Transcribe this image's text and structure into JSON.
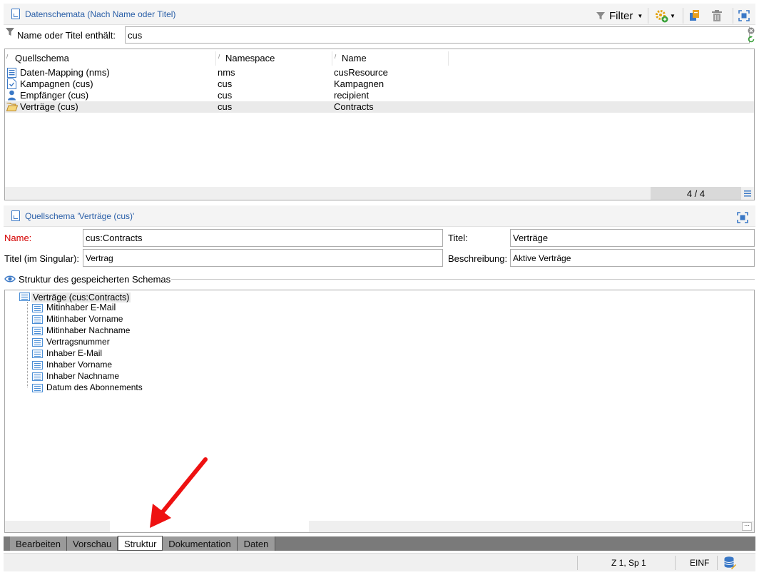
{
  "top_panel": {
    "title": "Datenschemata (Nach Name oder Titel)",
    "filter_label": "Filter",
    "filter_row_label": "Name oder Titel enthält:",
    "filter_value": "cus"
  },
  "list": {
    "columns": [
      "Quellschema",
      "Namespace",
      "Name"
    ],
    "rows": [
      {
        "schema": "Daten-Mapping (nms)",
        "namespace": "nms",
        "name": "cusResource",
        "icon": "document-list-icon"
      },
      {
        "schema": "Kampagnen (cus)",
        "namespace": "cus",
        "name": "Kampagnen",
        "icon": "schema-doc-icon"
      },
      {
        "schema": "Empfänger (cus)",
        "namespace": "cus",
        "name": "recipient",
        "icon": "person-icon"
      },
      {
        "schema": "Verträge (cus)",
        "namespace": "cus",
        "name": "Contracts",
        "icon": "open-folder-icon"
      }
    ],
    "count": "4 / 4"
  },
  "detail": {
    "title": "Quellschema 'Verträge (cus)'",
    "name_label": "Name:",
    "name_value": "cus:Contracts",
    "titel_label": "Titel:",
    "titel_value": "Verträge",
    "singular_label": "Titel (im Singular):",
    "singular_value": "Vertrag",
    "beschreibung_label": "Beschreibung:",
    "beschreibung_value": "Aktive Verträge",
    "structure_label": "Struktur des gespeicherten Schemas"
  },
  "tree": {
    "root": "Verträge (cus:Contracts)",
    "children": [
      "Mitinhaber E-Mail",
      "Mitinhaber Vorname",
      "Mitinhaber Nachname",
      "Vertragsnummer",
      "Inhaber E-Mail",
      "Inhaber Vorname",
      "Inhaber Nachname",
      "Datum des Abonnements"
    ]
  },
  "tabs": [
    "Bearbeiten",
    "Vorschau",
    "Struktur",
    "Dokumentation",
    "Daten"
  ],
  "active_tab": "Struktur",
  "status": {
    "position": "Z 1, Sp 1",
    "mode": "EINF"
  },
  "colors": {
    "accent": "#2a5fa8",
    "required_label": "#d40000",
    "arrow": "#ee1111"
  }
}
